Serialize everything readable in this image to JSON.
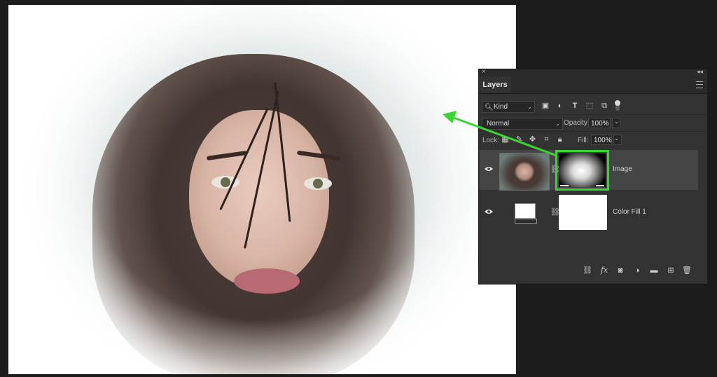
{
  "panel": {
    "tab_label": "Layers",
    "kind_filter": {
      "label": "Kind",
      "icon": "search-icon"
    },
    "filter_icons": [
      "pixel-layer-filter-icon",
      "adjustment-layer-filter-icon",
      "type-layer-filter-icon",
      "shape-layer-filter-icon",
      "smart-object-filter-icon"
    ],
    "blend_mode": "Normal",
    "opacity_label": "Opacity:",
    "opacity_value": "100%",
    "lock_label": "Lock:",
    "lock_icons": [
      "lock-transparent-pixels-icon",
      "lock-image-pixels-icon",
      "lock-position-icon",
      "lock-artboard-icon",
      "lock-all-icon"
    ],
    "fill_label": "Fill:",
    "fill_value": "100%",
    "layers": [
      {
        "name": "Image",
        "selected": true,
        "visible": true,
        "has_mask": true
      },
      {
        "name": "Color Fill 1",
        "selected": false,
        "visible": true,
        "has_mask": true
      }
    ],
    "bottom_icons": [
      "link-layers-icon",
      "fx-icon",
      "add-mask-icon",
      "adjustment-icon",
      "new-group-icon",
      "new-layer-icon",
      "delete-icon"
    ]
  },
  "colors": {
    "highlight": "#38d630",
    "panel_bg": "#323232",
    "page_bg": "#1c1c1c",
    "selected_layer": "#454545"
  }
}
